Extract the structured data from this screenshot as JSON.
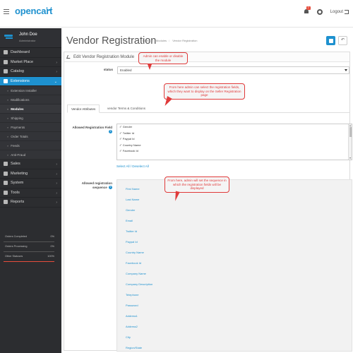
{
  "header": {
    "logo": "opencart",
    "notification_count": "2",
    "logout_label": "Logout"
  },
  "profile": {
    "name": "John Doe",
    "role": "Administrator"
  },
  "sidebar": {
    "items": [
      {
        "label": "Dashboard",
        "icon": "dashboard-icon"
      },
      {
        "label": "Market Place",
        "icon": "puzzle-icon"
      },
      {
        "label": "Catalog",
        "icon": "tag-icon"
      },
      {
        "label": "Extensions",
        "icon": "puzzle-icon",
        "active": true
      }
    ],
    "subitems": [
      {
        "label": "Extension Installer"
      },
      {
        "label": "Modifications"
      },
      {
        "label": "Modules",
        "current": true
      },
      {
        "label": "Shipping"
      },
      {
        "label": "Payments"
      },
      {
        "label": "Order Totals"
      },
      {
        "label": "Feeds"
      },
      {
        "label": "Anti-Fraud"
      }
    ],
    "items_after": [
      {
        "label": "Sales",
        "icon": "cart-icon"
      },
      {
        "label": "Marketing",
        "icon": "share-icon"
      },
      {
        "label": "System",
        "icon": "gear-icon"
      },
      {
        "label": "Tools",
        "icon": "wrench-icon"
      },
      {
        "label": "Reports",
        "icon": "bar-chart-icon"
      }
    ],
    "stats": [
      {
        "label": "Orders Completed",
        "percent": "0%",
        "fraction": 0,
        "color": "#1e91cf"
      },
      {
        "label": "Orders Processing",
        "percent": "0%",
        "fraction": 0,
        "color": "#f3a638"
      },
      {
        "label": "Other Statuses",
        "percent": "100%",
        "fraction": 1,
        "color": "#e74c3c"
      }
    ]
  },
  "page": {
    "title": "Vendor Registration",
    "breadcrumb": [
      "Home",
      "Modules",
      "Vendor Registration"
    ],
    "panel_title": "Edit Vendor Registration Module"
  },
  "form": {
    "status_label": "status",
    "status_value": "Enabled",
    "tabs": [
      "Vendor Attributes",
      "vendor Terms & Conditions"
    ],
    "allowed_fields_label": "Allowed Registration Field",
    "allowed_fields": [
      "Gender",
      "Twitter Id",
      "Paypal Id",
      "Country Name",
      "Facebook Id"
    ],
    "select_all": "Select All",
    "deselect_all": "Deselect All",
    "sequence_label": "Allowed registration sequence",
    "sequence": [
      "First Name",
      "Last Name",
      "Gender",
      "Email",
      "Twitter Id",
      "Paypal Id",
      "Country Name",
      "Facebook Id",
      "Company Name",
      "Company Description",
      "Telephone",
      "Password",
      "Address1",
      "Address2",
      "City",
      "Region/State"
    ]
  },
  "callouts": {
    "module": "Admin can enable or disable the module",
    "fields": "From here admin can select the registration fields, which they want to display on the Seller Registration page",
    "sequence": "From here, admin will set the sequence in which the registration fields will be displayed"
  },
  "colors": {
    "accent": "#1e91cf",
    "sidebar": "#2c2d30",
    "callout": "#e03a3a"
  }
}
